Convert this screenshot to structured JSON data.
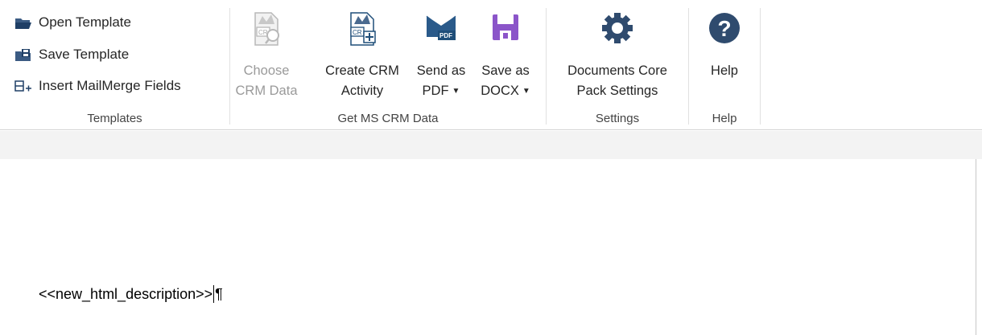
{
  "ribbon": {
    "templates": {
      "open_label": "Open Template",
      "save_label": "Save Template",
      "insert_label": "Insert MailMerge Fields",
      "group_label": "Templates"
    },
    "crm": {
      "choose_line1": "Choose",
      "choose_line2": "CRM Data",
      "create_line1": "Create CRM",
      "create_line2": "Activity",
      "pdf_line1": "Send as",
      "pdf_line2": "PDF",
      "docx_line1": "Save as",
      "docx_line2": "DOCX",
      "group_label": "Get MS CRM Data"
    },
    "settings": {
      "line1": "Documents Core",
      "line2": "Pack Settings",
      "group_label": "Settings"
    },
    "help": {
      "label": "Help",
      "group_label": "Help"
    }
  },
  "icons": {
    "pdf_badge": "PDF",
    "crm_badge": "CR",
    "help_glyph": "?"
  },
  "document": {
    "field_text": "<<new_html_description>>",
    "paragraph_mark": "¶"
  },
  "colors": {
    "accent_blue": "#1f4e79",
    "pdf_blue": "#2a5a8a",
    "docx_purple": "#8b55c9",
    "gear_navy": "#2f4b6e"
  }
}
